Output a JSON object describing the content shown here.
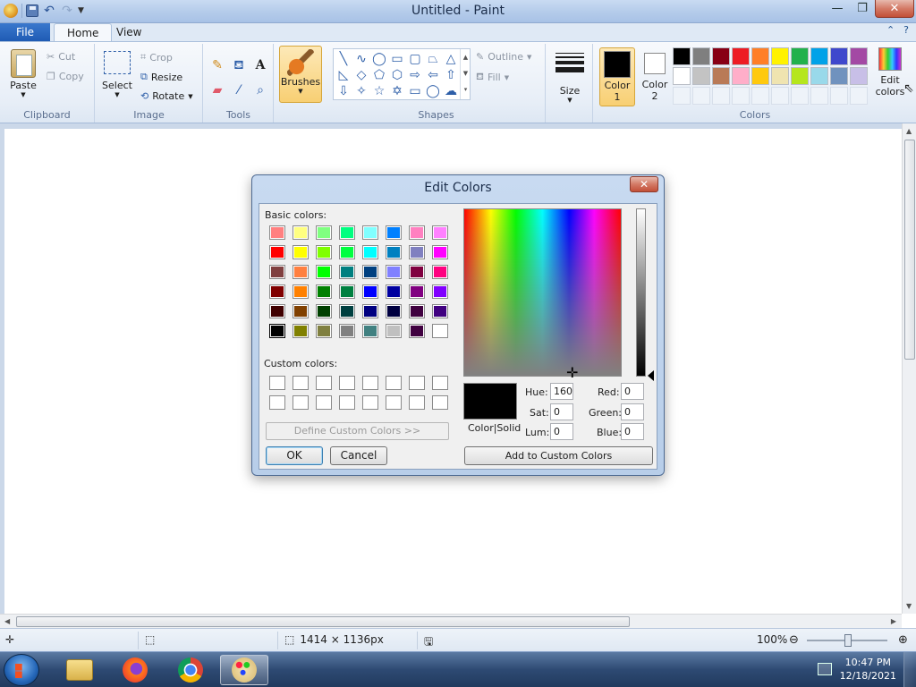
{
  "window": {
    "title": "Untitled - Paint",
    "minimize": "—",
    "restore": "❐",
    "close": "✕"
  },
  "ribbon_tabs": {
    "file": "File",
    "home": "Home",
    "view": "View"
  },
  "clipboard": {
    "paste": "Paste",
    "cut": "Cut",
    "copy": "Copy",
    "group": "Clipboard"
  },
  "image": {
    "select": "Select",
    "crop": "Crop",
    "resize": "Resize",
    "rotate": "Rotate",
    "group": "Image"
  },
  "tools": {
    "group": "Tools"
  },
  "brushes": {
    "label": "Brushes"
  },
  "shapes": {
    "outline": "Outline",
    "fill": "Fill",
    "group": "Shapes"
  },
  "size": {
    "label": "Size"
  },
  "colors": {
    "color1_line1": "Color",
    "color1_line2": "1",
    "color2_line1": "Color",
    "color2_line2": "2",
    "edit_line1": "Edit",
    "edit_line2": "colors",
    "group": "Colors",
    "color1_value": "#000000",
    "color2_value": "#ffffff",
    "palette": [
      "#000000",
      "#7f7f7f",
      "#880015",
      "#ed1c24",
      "#ff7f27",
      "#fff200",
      "#22b14c",
      "#00a2e8",
      "#3f48cc",
      "#a349a4",
      "#ffffff",
      "#c3c3c3",
      "#b97a57",
      "#ffaec9",
      "#ffc90e",
      "#efe4b0",
      "#b5e61d",
      "#99d9ea",
      "#7092be",
      "#c8bfe7"
    ],
    "empty_slots": 10
  },
  "status": {
    "dimensions": "1414 × 1136px",
    "zoom": "100%"
  },
  "taskbar": {
    "time": "10:47 PM",
    "date": "12/18/2021"
  },
  "dialog": {
    "title": "Edit Colors",
    "close": "✕",
    "basic_label": "Basic colors:",
    "basic_colors": [
      "#ff8080",
      "#ffff80",
      "#80ff80",
      "#00ff80",
      "#80ffff",
      "#0080ff",
      "#ff80c0",
      "#ff80ff",
      "#ff0000",
      "#ffff00",
      "#80ff00",
      "#00ff40",
      "#00ffff",
      "#0080c0",
      "#8080c0",
      "#ff00ff",
      "#804040",
      "#ff8040",
      "#00ff00",
      "#008080",
      "#004080",
      "#8080ff",
      "#800040",
      "#ff0080",
      "#800000",
      "#ff8000",
      "#008000",
      "#008040",
      "#0000ff",
      "#0000a0",
      "#800080",
      "#8000ff",
      "#400000",
      "#804000",
      "#004000",
      "#004040",
      "#000080",
      "#000040",
      "#400040",
      "#400080",
      "#000000",
      "#808000",
      "#808040",
      "#808080",
      "#408080",
      "#c0c0c0",
      "#400040",
      "#ffffff"
    ],
    "selected_basic_index": 40,
    "custom_label": "Custom colors:",
    "define_custom": "Define Custom Colors >>",
    "ok": "OK",
    "cancel": "Cancel",
    "color_solid": "Color|Solid",
    "hue_label": "Hue:",
    "hue": "160",
    "sat_label": "Sat:",
    "sat": "0",
    "lum_label": "Lum:",
    "lum": "0",
    "red_label": "Red:",
    "red": "0",
    "green_label": "Green:",
    "green": "0",
    "blue_label": "Blue:",
    "blue": "0",
    "add_custom": "Add to Custom Colors"
  }
}
